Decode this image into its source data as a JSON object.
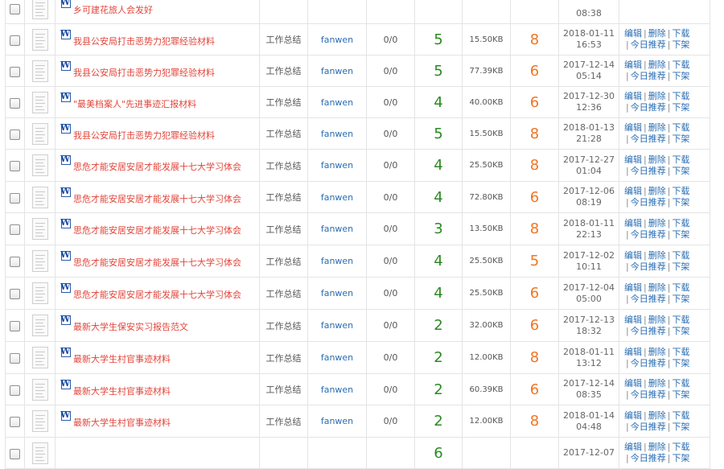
{
  "rows": [
    {
      "title": "乡可建花旅人会发好",
      "category": "",
      "user": "",
      "count": "",
      "score": "",
      "size": "",
      "price": "",
      "date": "",
      "time": "08:38"
    },
    {
      "title": "我县公安局打击恶势力犯罪经验材料",
      "category": "工作总结",
      "user": "fanwen",
      "count": "0/0",
      "score": "5",
      "size": "15.50KB",
      "price": "8",
      "date": "2018-01-11",
      "time": "16:53"
    },
    {
      "title": "我县公安局打击恶势力犯罪经验材料",
      "category": "工作总结",
      "user": "fanwen",
      "count": "0/0",
      "score": "5",
      "size": "77.39KB",
      "price": "6",
      "date": "2017-12-14",
      "time": "05:14"
    },
    {
      "title": "\"最美档案人\"先进事迹汇报材料",
      "category": "工作总结",
      "user": "fanwen",
      "count": "0/0",
      "score": "4",
      "size": "40.00KB",
      "price": "6",
      "date": "2017-12-30",
      "time": "12:36"
    },
    {
      "title": "我县公安局打击恶势力犯罪经验材料",
      "category": "工作总结",
      "user": "fanwen",
      "count": "0/0",
      "score": "5",
      "size": "15.50KB",
      "price": "8",
      "date": "2018-01-13",
      "time": "21:28"
    },
    {
      "title": "思危才能安居安居才能发展十七大学习体会",
      "category": "工作总结",
      "user": "fanwen",
      "count": "0/0",
      "score": "4",
      "size": "25.50KB",
      "price": "8",
      "date": "2017-12-27",
      "time": "01:04"
    },
    {
      "title": "思危才能安居安居才能发展十七大学习体会",
      "category": "工作总结",
      "user": "fanwen",
      "count": "0/0",
      "score": "4",
      "size": "72.80KB",
      "price": "6",
      "date": "2017-12-06",
      "time": "08:19"
    },
    {
      "title": "思危才能安居安居才能发展十七大学习体会",
      "category": "工作总结",
      "user": "fanwen",
      "count": "0/0",
      "score": "3",
      "size": "13.50KB",
      "price": "8",
      "date": "2018-01-11",
      "time": "22:13"
    },
    {
      "title": "思危才能安居安居才能发展十七大学习体会",
      "category": "工作总结",
      "user": "fanwen",
      "count": "0/0",
      "score": "4",
      "size": "25.50KB",
      "price": "5",
      "date": "2017-12-02",
      "time": "10:11"
    },
    {
      "title": "思危才能安居安居才能发展十七大学习体会",
      "category": "工作总结",
      "user": "fanwen",
      "count": "0/0",
      "score": "4",
      "size": "25.50KB",
      "price": "6",
      "date": "2017-12-04",
      "time": "05:00"
    },
    {
      "title": "最新大学生保安实习报告范文",
      "category": "工作总结",
      "user": "fanwen",
      "count": "0/0",
      "score": "2",
      "size": "32.00KB",
      "price": "6",
      "date": "2017-12-13",
      "time": "18:32"
    },
    {
      "title": "最新大学生村官事迹材料",
      "category": "工作总结",
      "user": "fanwen",
      "count": "0/0",
      "score": "2",
      "size": "12.00KB",
      "price": "8",
      "date": "2018-01-11",
      "time": "13:12"
    },
    {
      "title": "最新大学生村官事迹材料",
      "category": "工作总结",
      "user": "fanwen",
      "count": "0/0",
      "score": "2",
      "size": "60.39KB",
      "price": "6",
      "date": "2017-12-14",
      "time": "08:35"
    },
    {
      "title": "最新大学生村官事迹材料",
      "category": "工作总结",
      "user": "fanwen",
      "count": "0/0",
      "score": "2",
      "size": "12.00KB",
      "price": "8",
      "date": "2018-01-14",
      "time": "04:48"
    },
    {
      "title": "",
      "category": "",
      "user": "",
      "count": "",
      "score": "6",
      "size": "",
      "price": "",
      "date": "2017-12-07",
      "time": ""
    }
  ],
  "actions": {
    "edit": "编辑",
    "delete": "删除",
    "shelve": "下载",
    "recommend": "今日推荐",
    "unshelve": "下架",
    "separator": "|"
  },
  "icons": {
    "file_type": "W"
  },
  "colors": {
    "title_link": "#e2453a",
    "user_link": "#2a6db2",
    "score": "#2a8a22",
    "price": "#f07523",
    "grid": "#e4e4e4"
  }
}
